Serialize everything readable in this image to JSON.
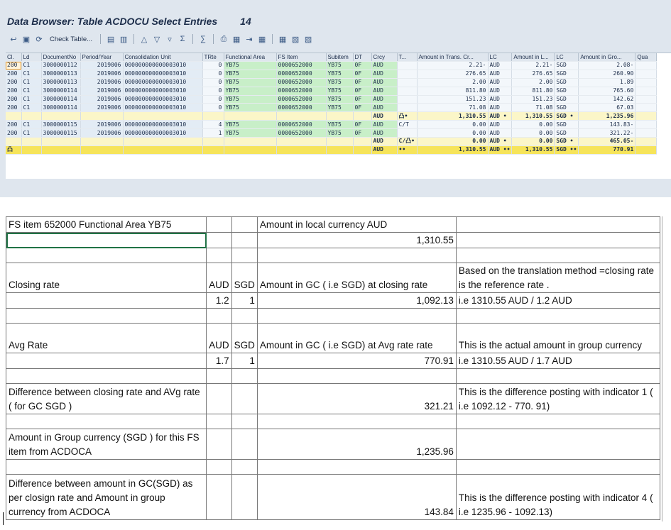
{
  "window": {
    "title": "Data Browser: Table ACDOCU Select Entries",
    "count": "14"
  },
  "toolbar": {
    "check_table_label": "Check Table..."
  },
  "grid": {
    "columns": [
      "Cl.",
      "Ld",
      "DocumentNo",
      "Period/Year",
      "Consolidation Unit",
      "TRte",
      "Functional Area",
      "FS Item",
      "Subitem",
      "DT",
      "Crcy",
      "T...",
      "Amount in Trans. Cr...",
      "LC",
      "Amount in L...",
      "LC",
      "Amount in Gro...",
      "Qua"
    ],
    "rows": [
      {
        "type": "row",
        "cells": [
          "200",
          "C1",
          "3000000112",
          "2019006",
          "000000000000003010",
          "0",
          "YB75",
          "0000652000",
          "YB75",
          "0F",
          "AUD",
          "",
          "2.21-",
          "AUD",
          "2.21-",
          "SGD",
          "2.08-",
          ""
        ]
      },
      {
        "type": "row",
        "cells": [
          "200",
          "C1",
          "3000000113",
          "2019006",
          "000000000000003010",
          "0",
          "YB75",
          "0000652000",
          "YB75",
          "0F",
          "AUD",
          "",
          "276.65",
          "AUD",
          "276.65",
          "SGD",
          "260.90",
          ""
        ]
      },
      {
        "type": "row",
        "cells": [
          "200",
          "C1",
          "3000000113",
          "2019006",
          "000000000000003010",
          "0",
          "YB75",
          "0000652000",
          "YB75",
          "0F",
          "AUD",
          "",
          "2.00",
          "AUD",
          "2.00",
          "SGD",
          "1.89",
          ""
        ]
      },
      {
        "type": "row",
        "cells": [
          "200",
          "C1",
          "3000000114",
          "2019006",
          "000000000000003010",
          "0",
          "YB75",
          "0000652000",
          "YB75",
          "0F",
          "AUD",
          "",
          "811.80",
          "AUD",
          "811.80",
          "SGD",
          "765.60",
          ""
        ]
      },
      {
        "type": "row",
        "cells": [
          "200",
          "C1",
          "3000000114",
          "2019006",
          "000000000000003010",
          "0",
          "YB75",
          "0000652000",
          "YB75",
          "0F",
          "AUD",
          "",
          "151.23",
          "AUD",
          "151.23",
          "SGD",
          "142.62",
          ""
        ]
      },
      {
        "type": "row",
        "cells": [
          "200",
          "C1",
          "3000000114",
          "2019006",
          "000000000000003010",
          "0",
          "YB75",
          "0000652000",
          "YB75",
          "0F",
          "AUD",
          "",
          "71.08",
          "AUD",
          "71.08",
          "SGD",
          "67.03",
          ""
        ]
      },
      {
        "type": "sub",
        "cells": [
          "",
          "",
          "",
          "",
          "",
          "",
          "",
          "",
          "",
          "",
          "AUD",
          "凸•",
          "1,310.55",
          "AUD •",
          "1,310.55",
          "SGD •",
          "1,235.96",
          ""
        ]
      },
      {
        "type": "row",
        "cells": [
          "200",
          "C1",
          "3000000115",
          "2019006",
          "000000000000003010",
          "4",
          "YB75",
          "0000652000",
          "YB75",
          "0F",
          "AUD",
          "C/T",
          "0.00",
          "AUD",
          "0.00",
          "SGD",
          "143.83-",
          ""
        ]
      },
      {
        "type": "row",
        "cells": [
          "200",
          "C1",
          "3000000115",
          "2019006",
          "000000000000003010",
          "1",
          "YB75",
          "0000652000",
          "YB75",
          "0F",
          "AUD",
          "",
          "0.00",
          "AUD",
          "0.00",
          "SGD",
          "321.22-",
          ""
        ]
      },
      {
        "type": "sub",
        "cells": [
          "",
          "",
          "",
          "",
          "",
          "",
          "",
          "",
          "",
          "",
          "AUD",
          "C/凸•",
          "0.00",
          "AUD •",
          "0.00",
          "SGD •",
          "465.05-",
          ""
        ]
      },
      {
        "type": "tot",
        "cells": [
          "凸",
          "",
          "",
          "",
          "",
          "",
          "",
          "",
          "",
          "",
          "AUD",
          "••",
          "1,310.55",
          "AUD ••",
          "1,310.55",
          "SGD ••",
          "770.91",
          ""
        ]
      }
    ]
  },
  "sheet": {
    "r1": {
      "a": "FS item 652000 Functional Area YB75",
      "d": "Amount in local currency AUD"
    },
    "r2": {
      "d": "1,310.55"
    },
    "r4": {
      "a": "Closing rate",
      "b": "AUD",
      "c": "SGD",
      "d": "Amount in GC ( i.e SGD) at closing rate",
      "e": "Based on the translation method =closing rate is the reference rate ."
    },
    "r5": {
      "b": "1.2",
      "c": "1",
      "d": "1,092.13",
      "e": "i.e 1310.55 AUD / 1.2 AUD"
    },
    "r7": {
      "a": "Avg Rate",
      "b": "AUD",
      "c": "SGD",
      "d": "Amount in GC ( i.e SGD) at Avg rate rate",
      "e": "This is the actual amount in group currency"
    },
    "r8": {
      "b": "1.7",
      "c": "1",
      "d": "770.91",
      "e": "i.e 1310.55 AUD / 1.7 AUD"
    },
    "r10": {
      "a": "Difference between closing rate and AVg rate ( for GC SGD )",
      "d": "321.21",
      "e": "This is the difference posting with indicator 1 ( i.e 1092.12 - 770. 91)"
    },
    "r12": {
      "a": "Amount in Group currency (SGD ) for this FS item from ACDOCA",
      "d": "1,235.96"
    },
    "r14": {
      "a": "Difference between amount in GC(SGD) as per closign rate and Amount in group currency from ACDOCA",
      "d": "143.84",
      "e": "This is the difference posting with indicator 4 ( i.e 1235.96 - 1092.13)"
    }
  }
}
